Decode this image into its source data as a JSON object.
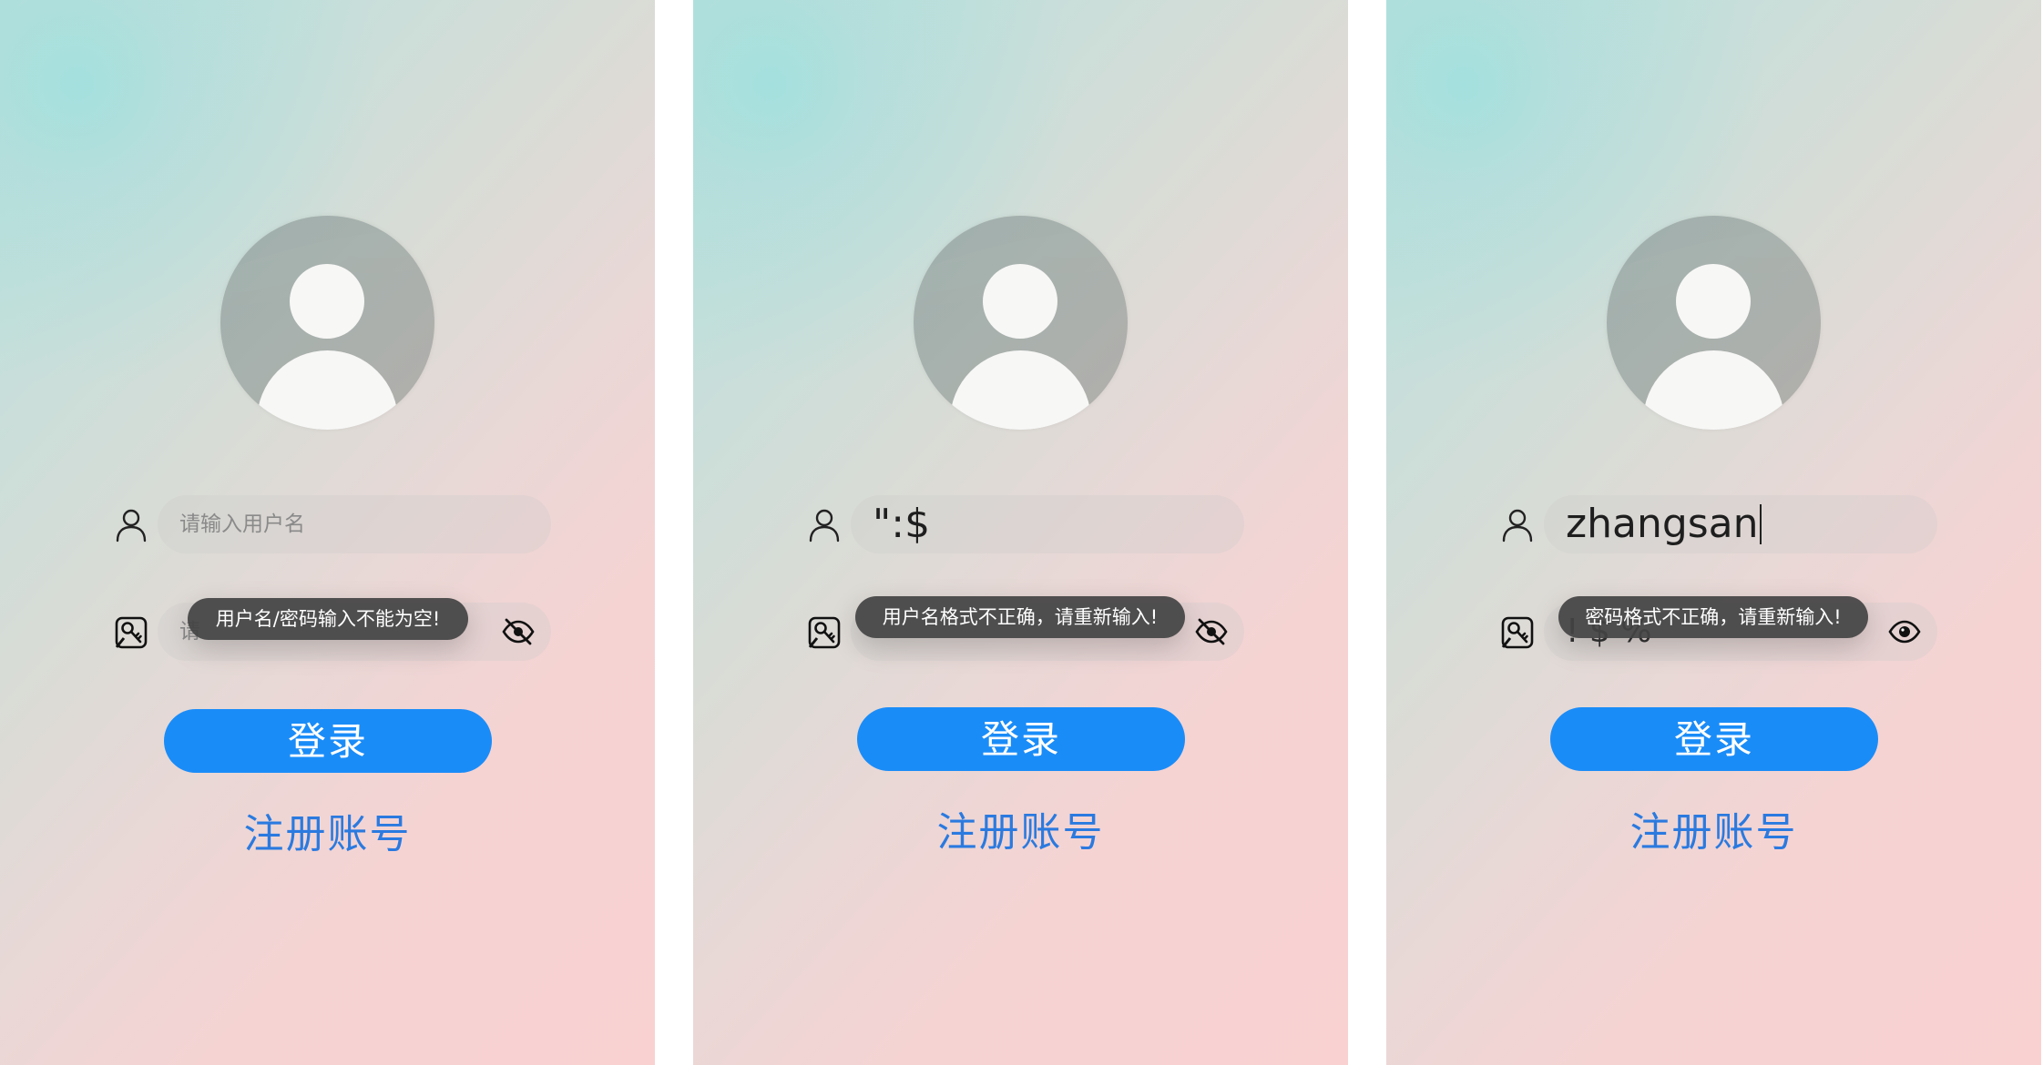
{
  "colors": {
    "button_bg": "#1a8cf8",
    "link": "#2a7ae0",
    "toast_bg": "#424242"
  },
  "screens": [
    {
      "username": {
        "placeholder": "请输入用户名",
        "value": ""
      },
      "password": {
        "partial_visible": "请"
      },
      "eye_icon": "eye-off-icon",
      "toast": "用户名/密码输入不能为空!",
      "login": "登录",
      "register": "注册账号"
    },
    {
      "username": {
        "placeholder": "",
        "value": "\":$"
      },
      "password": {
        "partial_visible": ""
      },
      "eye_icon": "eye-off-icon",
      "toast": "用户名格式不正确，请重新输入!",
      "login": "登录",
      "register": "注册账号"
    },
    {
      "username": {
        "placeholder": "",
        "value": "zhangsan"
      },
      "password": {
        "partial_visible": "! $ %"
      },
      "eye_icon": "eye-icon",
      "toast": "密码格式不正确，请重新输入!",
      "login": "登录",
      "register": "注册账号"
    }
  ]
}
